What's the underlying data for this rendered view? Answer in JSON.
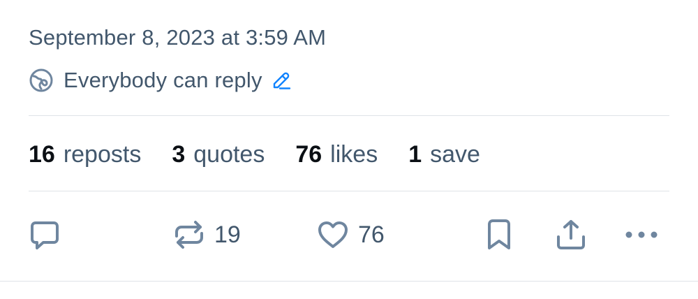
{
  "post": {
    "timestamp": "September 8, 2023 at 3:59 AM",
    "reply_setting": "Everybody can reply"
  },
  "stats": [
    {
      "count": "16",
      "label": "reposts"
    },
    {
      "count": "3",
      "label": "quotes"
    },
    {
      "count": "76",
      "label": "likes"
    },
    {
      "count": "1",
      "label": "save"
    }
  ],
  "actions": {
    "repost_count": "19",
    "like_count": "76"
  },
  "icons": {
    "reply": "speech-bubble-icon",
    "repost": "repost-arrows-icon",
    "like": "heart-icon",
    "bookmark": "bookmark-icon",
    "share": "share-upload-icon",
    "more": "ellipsis-icon",
    "globe": "globe-icon",
    "edit": "pencil-icon"
  },
  "colors": {
    "text_primary": "#0b0f14",
    "text_secondary": "#42576c",
    "icon": "#6f869f",
    "accent": "#1083fe",
    "divider": "#dfe3e7"
  }
}
